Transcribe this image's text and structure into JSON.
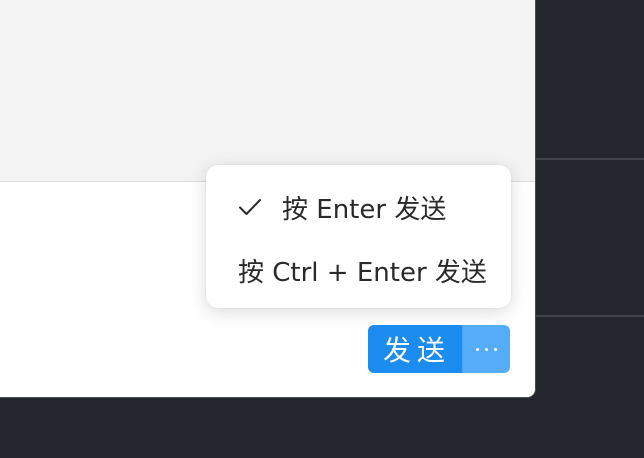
{
  "menu": {
    "items": [
      {
        "label": "按 Enter 发送",
        "checked": true,
        "icon": "check-icon"
      },
      {
        "label": "按 Ctrl + Enter 发送",
        "checked": false
      }
    ]
  },
  "send": {
    "label": "发送",
    "more_icon": "more-icon",
    "color": "#1c8cf0"
  }
}
